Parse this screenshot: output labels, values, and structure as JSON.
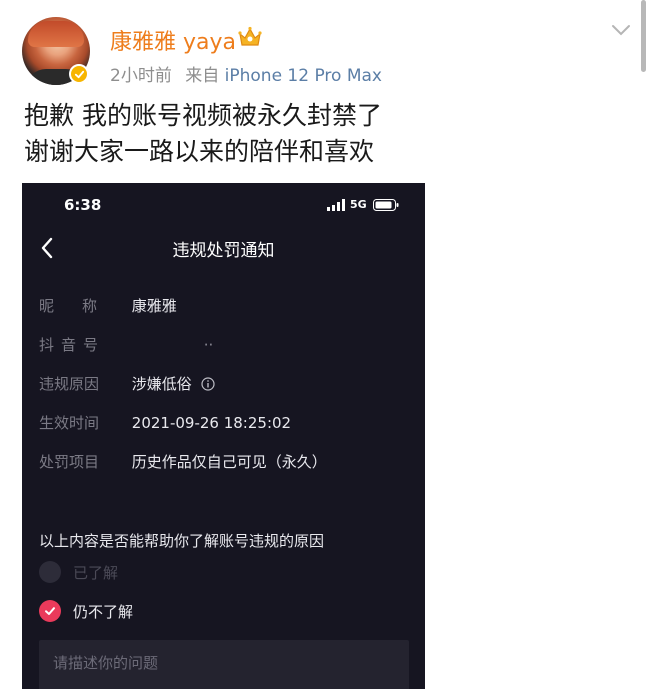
{
  "post": {
    "user_name": "康雅雅 yaya",
    "time": "2小时前",
    "source_prefix": "来自",
    "device": "iPhone 12 Pro Max",
    "text_line1": "抱歉 我的账号视频被永久封禁了",
    "text_line2": "谢谢大家一路以来的陪伴和喜欢",
    "icons": [
      "avatar",
      "verified-badge-icon",
      "crown-icon",
      "chevron-down-icon"
    ],
    "colors": {
      "username": "#ee7d1c",
      "device": "#5b7ea6",
      "verified": "#f7b500"
    }
  },
  "screenshot": {
    "status_time": "6:38",
    "network": "5G",
    "nav_title": "违规处罚通知",
    "fields": {
      "nickname": {
        "label": "昵称",
        "value": "康雅雅"
      },
      "douyin_id": {
        "label": "抖音号",
        "value": "··"
      },
      "reason": {
        "label": "违规原因",
        "value": "涉嫌低俗"
      },
      "effective_time": {
        "label": "生效时间",
        "value": "2021-09-26 18:25:02"
      },
      "penalty": {
        "label": "处罚项目",
        "value": "历史作品仅自己可见（永久）"
      }
    },
    "question": "以上内容是否能帮助你了解账号违规的原因",
    "option_understood": "已了解",
    "option_not_understood": "仍不了解",
    "selected_option": "仍不了解",
    "input_placeholder": "请描述你的问题",
    "colors": {
      "background": "#161521",
      "accent": "#ea3a5b"
    }
  }
}
